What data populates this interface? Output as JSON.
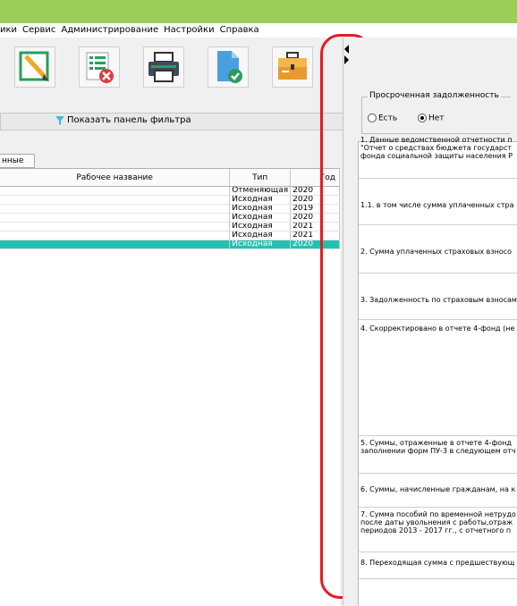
{
  "menu": [
    "ики",
    "Сервис",
    "Администрирование",
    "Настройки",
    "Справка"
  ],
  "toolbar": {
    "icons": [
      "edit-icon",
      "delete-icon",
      "print-icon",
      "approve-icon",
      "briefcase-icon"
    ]
  },
  "filter": {
    "label": "Показать панель фильтра"
  },
  "tab": {
    "label": "нные"
  },
  "table": {
    "headers": [
      "Рабочее название",
      "Тип",
      "Год"
    ],
    "rows": [
      {
        "name": "",
        "type": "Отменяющая",
        "year": "2020"
      },
      {
        "name": "",
        "type": "Исходная",
        "year": "2020"
      },
      {
        "name": "",
        "type": "Исходная",
        "year": "2019"
      },
      {
        "name": "",
        "type": "Исходная",
        "year": "2020"
      },
      {
        "name": "",
        "type": "Исходная",
        "year": "2021"
      },
      {
        "name": "",
        "type": "Исходная",
        "year": "2021"
      },
      {
        "name": "",
        "type": "Исходная",
        "year": "2020"
      }
    ],
    "selected_index": 6
  },
  "overdue": {
    "legend": "Просроченная задолженность",
    "option_yes": "Есть",
    "option_no": "Нет",
    "selected": "Нет"
  },
  "form_rows": [
    {
      "lines": [
        "1. Данные ведомственной отчетности п",
        "\"Отчет о средствах бюджета государст",
        "фонда социальной защиты населения Р"
      ]
    },
    {
      "lines": [
        "1.1. в том числе сумма уплаченных стра"
      ]
    },
    {
      "lines": [
        "2. Сумма уплаченных страховых взносо"
      ]
    },
    {
      "lines": [
        "3. Задолженность по страховым взносам"
      ]
    },
    {
      "lines": [
        "4. Скорректировано в отчете 4-фонд (не"
      ]
    },
    {
      "lines": [
        "5. Суммы, отраженные в отчете 4-фонд",
        "заполнении форм ПУ-3 в следующем отч"
      ]
    },
    {
      "lines": [
        "6. Суммы, начисленные гражданам, на к"
      ]
    },
    {
      "lines": [
        "7. Сумма пособий по временной нетрудо",
        "после даты увольнения с работы,отраж",
        "периодов 2013 - 2017 гг., с отчетного п"
      ]
    },
    {
      "lines": [
        "8. Переходящая сумма с предшествующ"
      ]
    }
  ],
  "colors": {
    "title_bar": "#9acd5a",
    "selected_row": "#26c0b0",
    "annotation": "#e31c25"
  }
}
